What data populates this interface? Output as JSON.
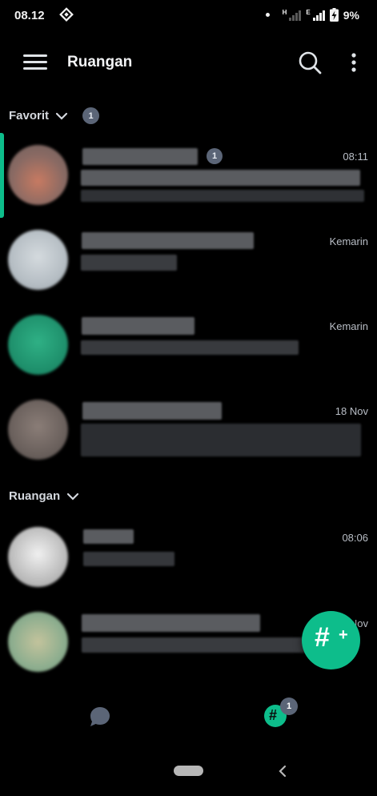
{
  "status_bar": {
    "time": "08.12",
    "network_label": "H",
    "network_label_2": "E",
    "battery_percent": "9%"
  },
  "app_bar": {
    "title": "Ruangan"
  },
  "sections": {
    "favorites": {
      "label": "Favorit",
      "count": "1"
    },
    "rooms": {
      "label": "Ruangan"
    }
  },
  "rooms": [
    {
      "timestamp": "08:11",
      "unread": "1",
      "avatar_color": "#8a6a63"
    },
    {
      "timestamp": "Kemarin",
      "avatar_color": "#b6bec4"
    },
    {
      "timestamp": "Kemarin",
      "avatar_color": "#1e8f6b"
    },
    {
      "timestamp": "18 Nov",
      "avatar_color": "#6b615d"
    },
    {
      "timestamp": "08:06",
      "avatar_color": "#bdbdbd"
    },
    {
      "timestamp": "Nov",
      "avatar_color": "#8eae8f"
    }
  ],
  "bottom_nav": {
    "rooms_badge": "1"
  },
  "colors": {
    "accent": "#0dbd8b",
    "badge": "#5b6577",
    "background": "#000000"
  }
}
